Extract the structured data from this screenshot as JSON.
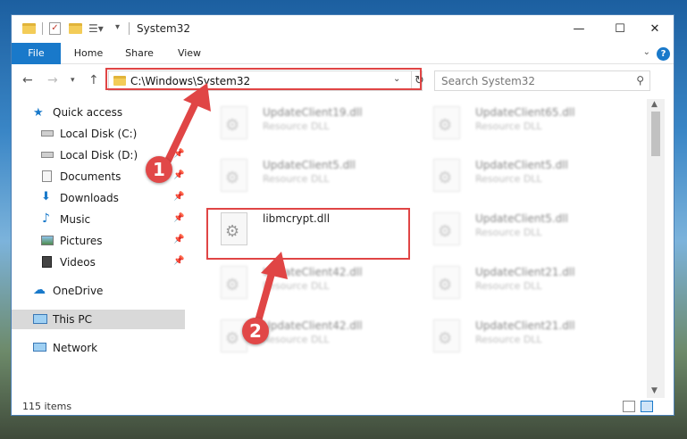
{
  "window": {
    "title": "System32",
    "minimize": "—",
    "maximize": "☐",
    "close": "✕"
  },
  "ribbon": {
    "tabs": [
      "File",
      "Home",
      "Share",
      "View"
    ],
    "help": "?"
  },
  "address": {
    "path": "C:\\Windows\\System32",
    "search_placeholder": "Search System32"
  },
  "sidebar": {
    "items": [
      {
        "label": "Quick access",
        "icon": "star-icon"
      },
      {
        "label": "Local Disk (C:)",
        "icon": "drive-icon"
      },
      {
        "label": "Local Disk (D:)",
        "icon": "drive-icon"
      },
      {
        "label": "Documents",
        "icon": "documents-icon"
      },
      {
        "label": "Downloads",
        "icon": "download-icon"
      },
      {
        "label": "Music",
        "icon": "music-icon"
      },
      {
        "label": "Pictures",
        "icon": "pictures-icon"
      },
      {
        "label": "Videos",
        "icon": "videos-icon"
      },
      {
        "label": "OneDrive",
        "icon": "cloud-icon"
      },
      {
        "label": "This PC",
        "icon": "computer-icon"
      },
      {
        "label": "Network",
        "icon": "network-icon"
      }
    ],
    "selected": "This PC"
  },
  "files": [
    {
      "name": "UpdateClient19.dll",
      "type": "Resource DLL",
      "blurred": true
    },
    {
      "name": "UpdateClient65.dll",
      "type": "Resource DLL",
      "blurred": true
    },
    {
      "name": "UpdateClient5.dll",
      "type": "Resource DLL",
      "blurred": true
    },
    {
      "name": "UpdateClient5.dll",
      "type": "Resource DLL",
      "blurred": true
    },
    {
      "name": "libmcrypt.dll",
      "type": "",
      "blurred": false
    },
    {
      "name": "UpdateClient5.dll",
      "type": "Resource DLL",
      "blurred": true
    },
    {
      "name": "UpdateClient42.dll",
      "type": "Resource DLL",
      "blurred": true
    },
    {
      "name": "UpdateClient21.dll",
      "type": "Resource DLL",
      "blurred": true
    },
    {
      "name": "UpdateClient42.dll",
      "type": "Resource DLL",
      "blurred": true
    },
    {
      "name": "UpdateClient21.dll",
      "type": "Resource DLL",
      "blurred": true
    }
  ],
  "status": {
    "items_count": "115 items"
  },
  "annotations": {
    "step1": "1",
    "step2": "2",
    "color": "#e04545"
  }
}
